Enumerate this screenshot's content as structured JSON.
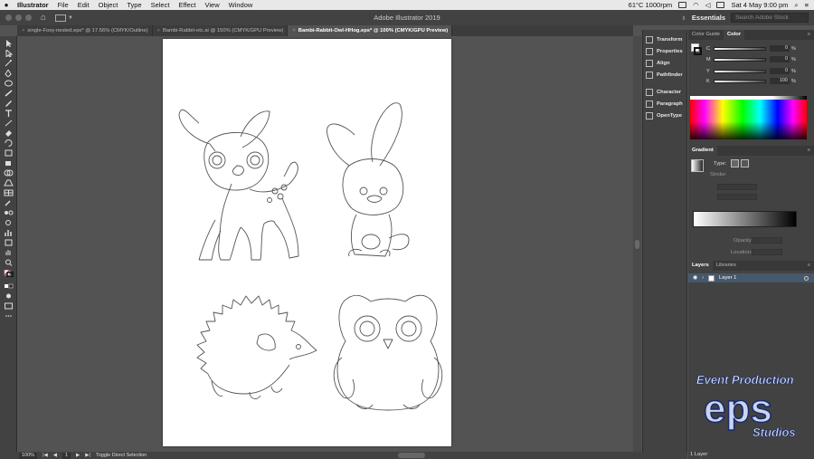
{
  "menubar": {
    "app_name": "Illustrator",
    "menus": [
      "File",
      "Edit",
      "Object",
      "Type",
      "Select",
      "Effect",
      "View",
      "Window"
    ],
    "temperature": "61°C 1000rpm",
    "clock": "Sat 4 May  9:00 pm"
  },
  "appbar": {
    "title": "Adobe Illustrator 2019",
    "workspace": "Essentials",
    "stock_placeholder": "Search Adobe Stock"
  },
  "tabs": [
    {
      "label": "single-Foxy-nested.eps* @ 17.56% (CMYK/Outline)"
    },
    {
      "label": "Bambi-Rabbit-etc.ai @ 150% (CMYK/GPU Preview)"
    },
    {
      "label": "Bambi-Rabbit-Owl-HHog.eps* @ 100% (CMYK/GPU Preview)"
    }
  ],
  "close_glyph": "×",
  "collapsed_panels": [
    "Transform",
    "Properties",
    "Align",
    "Pathfinder",
    "Character",
    "Paragraph",
    "OpenType"
  ],
  "color_panel": {
    "tabs": [
      "Color Guide",
      "Color"
    ],
    "channels": [
      {
        "label": "C",
        "value": "0",
        "unit": "%"
      },
      {
        "label": "M",
        "value": "0",
        "unit": "%"
      },
      {
        "label": "Y",
        "value": "0",
        "unit": "%"
      },
      {
        "label": "K",
        "value": "100",
        "unit": "%"
      }
    ]
  },
  "gradient_panel": {
    "title": "Gradient",
    "type_label": "Type:",
    "stroke_label": "Stroke:",
    "opacity_label": "Opacity:",
    "location_label": "Location:"
  },
  "layers_panel": {
    "tabs": [
      "Layers",
      "Libraries"
    ],
    "layer_name": "Layer 1",
    "count_label": "1 Layer"
  },
  "statusbar": {
    "zoom": "100%",
    "artboard": "1",
    "tool_hint": "Toggle Direct Selection"
  },
  "watermark": {
    "line1": "Event Production",
    "mark": "eps",
    "line2": "Studios"
  },
  "colors": {
    "ui_dark": "#424242",
    "canvas": "#535353",
    "layer_highlight": "#46586b"
  }
}
